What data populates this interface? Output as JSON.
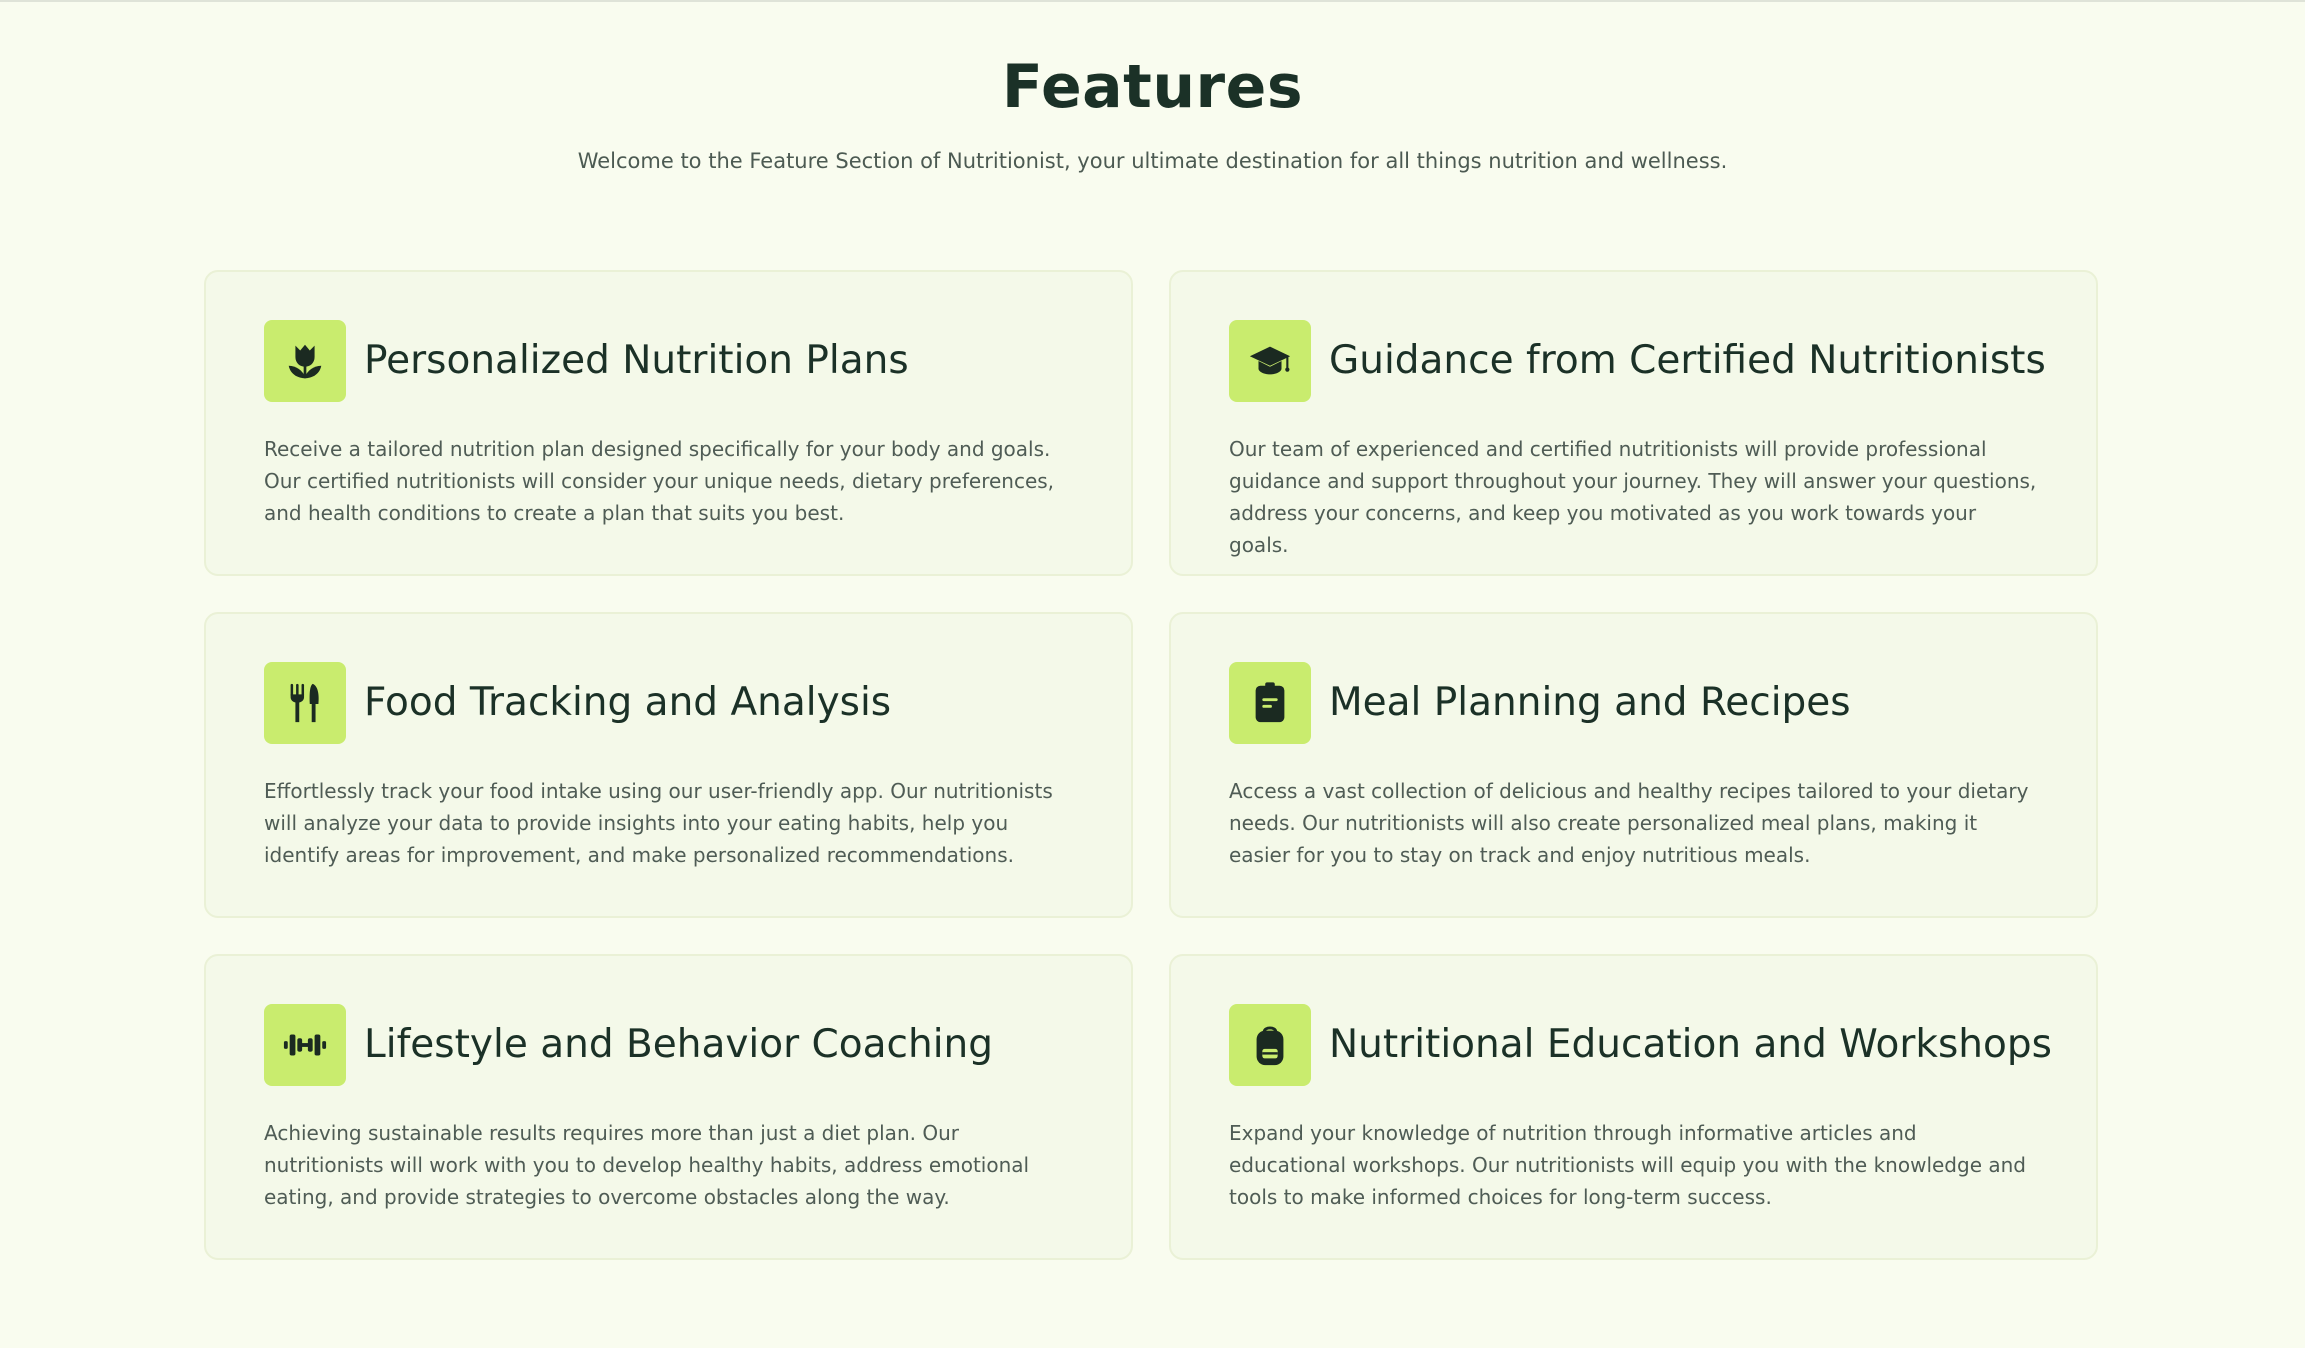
{
  "header": {
    "title": "Features",
    "subtitle": "Welcome to the Feature Section of Nutritionist, your ultimate destination for all things nutrition and wellness."
  },
  "colors": {
    "background": "#f9fcef",
    "card_background": "#f4f9e9",
    "card_border": "#eaf1d6",
    "icon_accent": "#c9ec6e",
    "heading": "#1b3127",
    "body_text": "#4f5c55"
  },
  "features": [
    {
      "icon": "tulip-icon",
      "title": "Personalized Nutrition Plans",
      "description": "Receive a tailored nutrition plan designed specifically for your body and goals. Our certified nutritionists will consider your unique needs, dietary preferences, and health conditions to create a plan that suits you best."
    },
    {
      "icon": "graduation-cap-icon",
      "title": "Guidance from Certified Nutritionists",
      "description": "Our team of experienced and certified nutritionists will provide professional guidance and support throughout your journey. They will answer your questions, address your concerns, and keep you motivated as you work towards your goals."
    },
    {
      "icon": "utensils-icon",
      "title": "Food Tracking and Analysis",
      "description": "Effortlessly track your food intake using our user-friendly app. Our nutritionists will analyze your data to provide insights into your eating habits, help you identify areas for improvement, and make personalized recommendations."
    },
    {
      "icon": "clipboard-icon",
      "title": "Meal Planning and Recipes",
      "description": "Access a vast collection of delicious and healthy recipes tailored to your dietary needs. Our nutritionists will also create personalized meal plans, making it easier for you to stay on track and enjoy nutritious meals."
    },
    {
      "icon": "dumbbell-icon",
      "title": "Lifestyle and Behavior Coaching",
      "description": "Achieving sustainable results requires more than just a diet plan. Our nutritionists will work with you to develop healthy habits, address emotional eating, and provide strategies to overcome obstacles along the way."
    },
    {
      "icon": "backpack-icon",
      "title": "Nutritional Education and Workshops",
      "description": "Expand your knowledge of nutrition through informative articles and educational workshops. Our nutritionists will equip you with the knowledge and tools to make informed choices for long-term success."
    }
  ]
}
